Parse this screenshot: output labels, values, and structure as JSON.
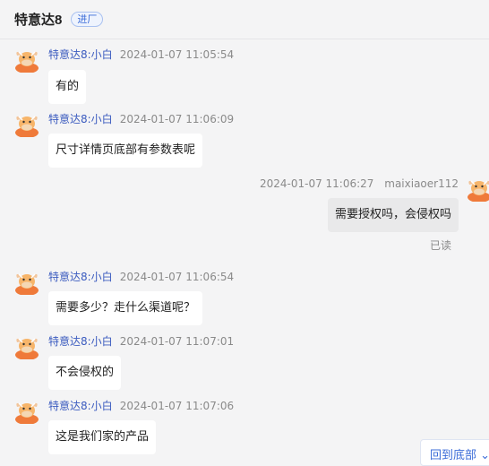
{
  "header": {
    "title": "特意达8",
    "tag": "进厂"
  },
  "messages": [
    {
      "sender": "特意达8:小白",
      "time": "2024-01-07 11:05:54",
      "text": "有的"
    },
    {
      "sender": "特意达8:小白",
      "time": "2024-01-07 11:06:09",
      "text": "尺寸详情页底部有参数表呢"
    },
    {
      "sender": "maixiaoer112",
      "time": "2024-01-07 11:06:27",
      "text": "需要授权吗，会侵权吗",
      "status": "已读"
    },
    {
      "sender": "特意达8:小白",
      "time": "2024-01-07 11:06:54",
      "text": "需要多少？走什么渠道呢？"
    },
    {
      "sender": "特意达8:小白",
      "time": "2024-01-07 11:07:01",
      "text": "不会侵权的"
    },
    {
      "sender": "特意达8:小白",
      "time": "2024-01-07 11:07:06",
      "text": "这是我们家的产品"
    }
  ],
  "back_to_bottom": "回到底部",
  "back_to_bottom_icon": "chevron-down-icon",
  "avatar_icon": "cow-avatar-icon",
  "colors": {
    "sender": "#3b5bbf",
    "bubble": "#ffffff",
    "my_bubble": "#e9e9ea",
    "avatar": "#f07a2e"
  }
}
